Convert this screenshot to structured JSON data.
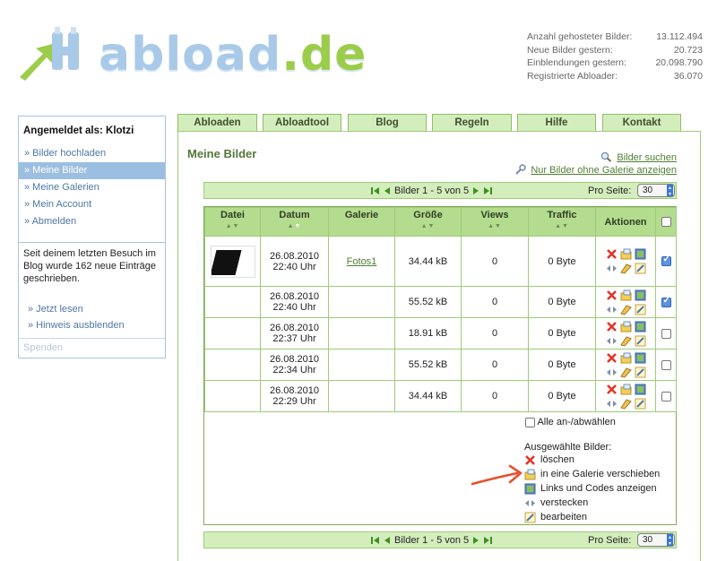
{
  "logo": {
    "word": "abload",
    "tld": ".de"
  },
  "stats": [
    {
      "label": "Anzahl gehosteter Bilder:",
      "value": "13.112.494"
    },
    {
      "label": "Neue Bilder gestern:",
      "value": "20.723"
    },
    {
      "label": "Einblendungen gestern:",
      "value": "20.098.790"
    },
    {
      "label": "Registrierte Abloader:",
      "value": "36.070"
    }
  ],
  "sidebar": {
    "heading": "Angemeldet als: Klotzi",
    "items": [
      {
        "label": "» Bilder hochladen"
      },
      {
        "label": "» Meine Bilder"
      },
      {
        "label": "» Meine Galerien"
      },
      {
        "label": "» Mein Account"
      },
      {
        "label": "» Abmelden"
      }
    ],
    "note": "Seit deinem letzten Besuch im Blog wurde 162 neue Einträge geschrieben.",
    "links": [
      {
        "label": "» Jetzt lesen"
      },
      {
        "label": "» Hinweis ausblenden"
      }
    ],
    "footer": "Spenden"
  },
  "tabs": [
    {
      "label": "Abloaden"
    },
    {
      "label": "Abloadtool"
    },
    {
      "label": "Blog"
    },
    {
      "label": "Regeln"
    },
    {
      "label": "Hilfe"
    },
    {
      "label": "Kontakt"
    }
  ],
  "main": {
    "title": "Meine Bilder",
    "search_link": "Bilder suchen",
    "no_gallery_link": "Nur Bilder ohne Galerie anzeigen"
  },
  "pager": {
    "range": "Bilder 1 - 5 von 5",
    "per_page_label": "Pro Seite:",
    "per_page_value": "30"
  },
  "table": {
    "columns": [
      "Datei",
      "Datum",
      "Galerie",
      "Größe",
      "Views",
      "Traffic",
      "Aktionen"
    ],
    "rows": [
      {
        "date": "26.08.2010",
        "time": "22:40 Uhr",
        "gallery": "Fotos1",
        "size": "34.44 kB",
        "views": "0",
        "traffic": "0 Byte",
        "checked": true
      },
      {
        "date": "26.08.2010",
        "time": "22:40 Uhr",
        "gallery": "",
        "size": "55.52 kB",
        "views": "0",
        "traffic": "0 Byte",
        "checked": true
      },
      {
        "date": "26.08.2010",
        "time": "22:37 Uhr",
        "gallery": "",
        "size": "18.91 kB",
        "views": "0",
        "traffic": "0 Byte",
        "checked": false
      },
      {
        "date": "26.08.2010",
        "time": "22:34 Uhr",
        "gallery": "",
        "size": "55.52 kB",
        "views": "0",
        "traffic": "0 Byte",
        "checked": false
      },
      {
        "date": "26.08.2010",
        "time": "22:29 Uhr",
        "gallery": "",
        "size": "34.44 kB",
        "views": "0",
        "traffic": "0 Byte",
        "checked": false
      }
    ]
  },
  "bulk": {
    "select_all": "Alle an-/abwählen",
    "title": "Ausgewählte Bilder:",
    "actions": [
      {
        "label": "löschen",
        "icon": "delete-icon"
      },
      {
        "label": "in eine Galerie verschieben",
        "icon": "move-to-gallery-icon"
      },
      {
        "label": "Links und Codes anzeigen",
        "icon": "links-codes-icon"
      },
      {
        "label": "verstecken",
        "icon": "hide-icon"
      },
      {
        "label": "bearbeiten",
        "icon": "edit-icon"
      }
    ]
  },
  "colors": {
    "accent_green": "#d3eebc",
    "header_green": "#b3dc8f",
    "link_blue": "#4d78a5",
    "annotation_arrow": "#e8502b"
  }
}
